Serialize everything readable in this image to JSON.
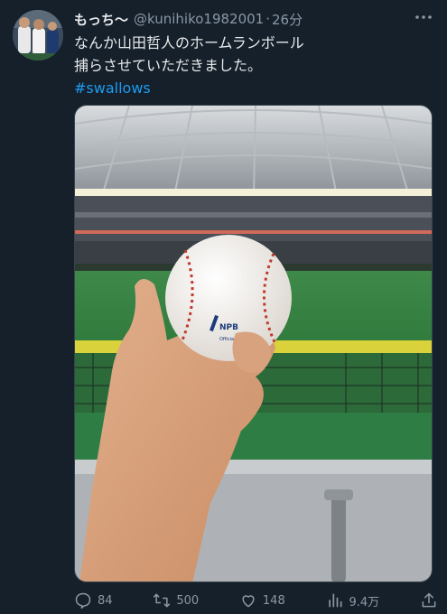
{
  "tweet": {
    "display_name": "もっち〜",
    "handle": "@kunihiko1982001",
    "separator": "·",
    "time": "26分",
    "text_lines": [
      "なんか山田哲人のホームランボール",
      "捕らさせていただきました。"
    ],
    "hashtag": "#swallows",
    "media": {
      "ball_logo_text": "NPB",
      "ball_sub_text": "Official Ball"
    }
  },
  "actions": {
    "replies": "84",
    "retweets": "500",
    "likes": "148",
    "views": "9.4万"
  },
  "colors": {
    "background": "#15202b",
    "text": "#e7e9ea",
    "secondary": "#8b98a5",
    "link": "#1d9bf0"
  },
  "icons": [
    "more-icon",
    "reply-icon",
    "retweet-icon",
    "like-icon",
    "views-icon",
    "share-icon"
  ]
}
